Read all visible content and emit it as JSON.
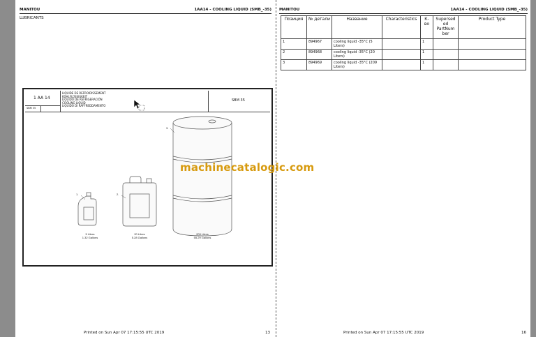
{
  "left_page": {
    "brand": "MANITOU",
    "section_code": "1AA14 - COOLING LIQUID (SMB_-35)",
    "section_title": "LUBRICANTS",
    "printed": "Printed on  Sun Apr 07 17:15:55 UTC 2019",
    "page_number": "13",
    "drawing": {
      "code": "1 AA 14",
      "sub_left": "SBM 35",
      "sub_right": "",
      "descriptions": [
        "LIQUIDE DE REFROIDISSEMENT",
        "KÜHLFLÜSSIGKEIT",
        "LÍQUIDO DE REFRIGERACIÓN",
        "COOLING LIQUID",
        "LIQUIDO DI RAFFREDDAMENTO"
      ],
      "model": "SBM 35",
      "callouts": [
        "1.",
        "2.",
        "3."
      ],
      "captions": [
        {
          "line1": "5 Litres",
          "line2": "1.32 Gallons"
        },
        {
          "line1": "20 Litres",
          "line2": "5.28 Gallons"
        },
        {
          "line1": "209 Litres",
          "line2": "55.29 Gallons"
        }
      ]
    }
  },
  "right_page": {
    "brand": "MANITOU",
    "section_code": "1AA14 - COOLING LIQUID (SMB_-35)",
    "printed": "Printed on  Sun Apr 07 17:15:55 UTC 2019",
    "page_number": "16",
    "table": {
      "headers": [
        "Позиция",
        "№ детали",
        "Название",
        "Characteristics",
        "К-во",
        "Supersed ed PartNum ber",
        "Product Type"
      ],
      "rows": [
        {
          "pos": "1",
          "part": "894967",
          "name": "cooling liquid -35°C (5 Liters)",
          "char": "",
          "qty": "1",
          "sup": "",
          "ptype": ""
        },
        {
          "pos": "2",
          "part": "894968",
          "name": "cooling liquid -35°C (20 Liters)",
          "char": "",
          "qty": "1",
          "sup": "",
          "ptype": ""
        },
        {
          "pos": "3",
          "part": "894969",
          "name": "cooling liquid -35°C (209 Liters)",
          "char": "",
          "qty": "1",
          "sup": "",
          "ptype": ""
        }
      ]
    }
  },
  "watermark": "machinecatalogic.com"
}
